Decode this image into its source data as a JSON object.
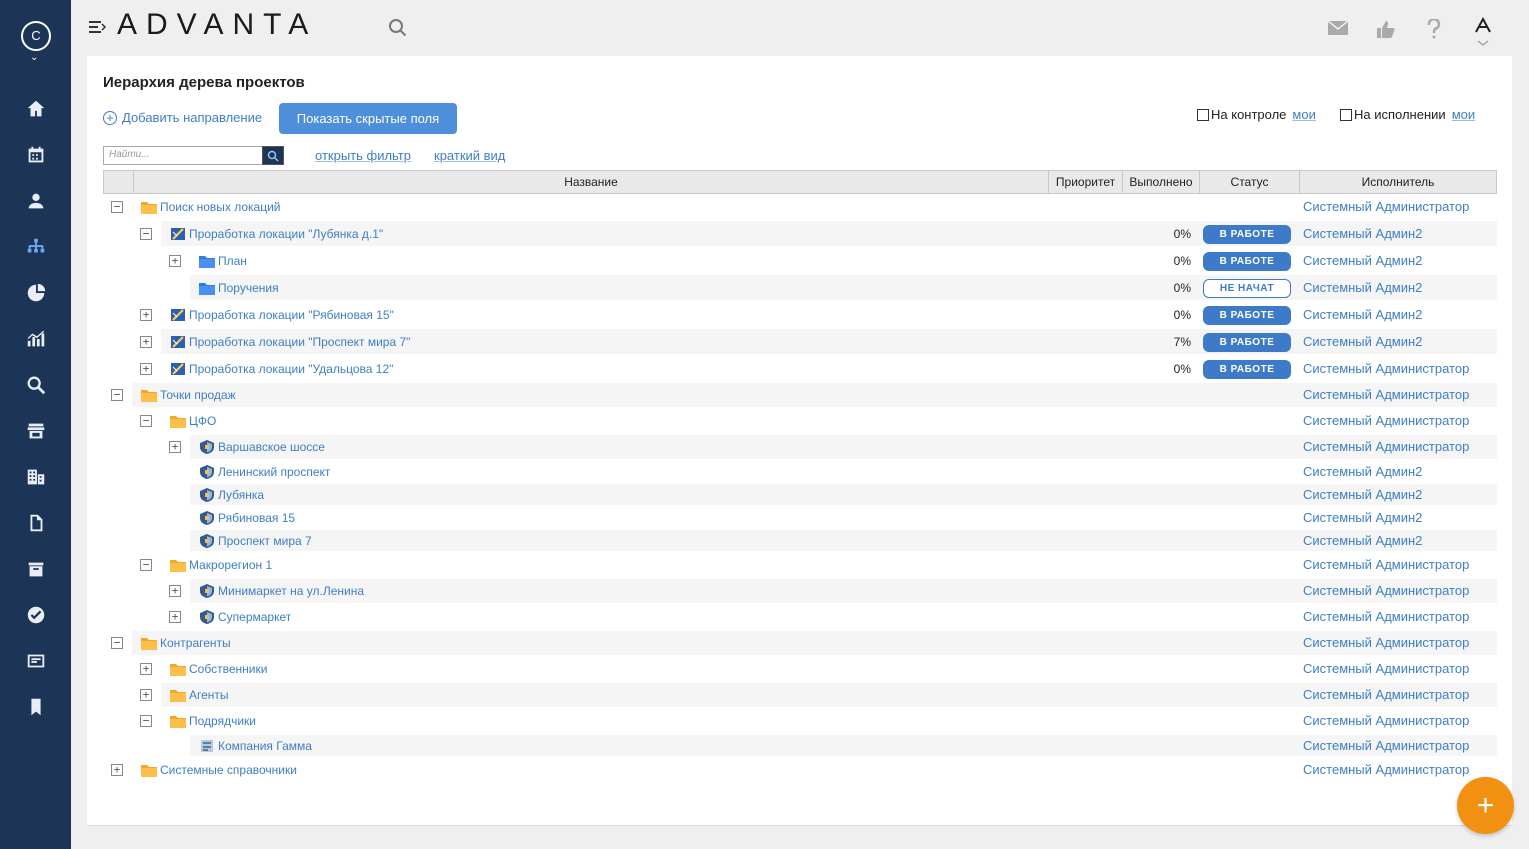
{
  "user": {
    "avatar_letter": "С"
  },
  "brand": {
    "logo": "ADVANTA"
  },
  "page": {
    "title": "Иерархия дерева проектов",
    "add_direction": "Добавить направление",
    "show_hidden": "Показать скрытые поля",
    "control_label": "На контроле",
    "execution_label": "На исполнении",
    "mine_link": "мои",
    "search_placeholder": "Найти...",
    "open_filter": "открыть фильтр",
    "short_view": "краткий вид"
  },
  "columns": {
    "name": "Название",
    "priority": "Приоритет",
    "done": "Выполнено",
    "status": "Статус",
    "owner": "Исполнитель"
  },
  "rows": [
    {
      "name": "Поиск новых локаций",
      "level": 0,
      "toggle": "−",
      "icon": "folder-orange-icon",
      "pct": "",
      "status": "",
      "owner": "Системный Администратор"
    },
    {
      "name": "Проработка локации \"Лубянка д.1\"",
      "level": 1,
      "toggle": "−",
      "icon": "project-icon",
      "pct": "0%",
      "status": "В РАБОТЕ",
      "owner": "Системный Админ2"
    },
    {
      "name": "План",
      "level": 2,
      "toggle": "+",
      "icon": "folder-blue-icon",
      "pct": "0%",
      "status": "В РАБОТЕ",
      "owner": "Системный Админ2"
    },
    {
      "name": "Поручения",
      "level": 2,
      "toggle": "",
      "icon": "folder-blue-icon",
      "pct": "0%",
      "status": "НЕ НАЧАТ",
      "owner": "Системный Админ2"
    },
    {
      "name": "Проработка локации \"Рябиновая 15\"",
      "level": 1,
      "toggle": "+",
      "icon": "project-icon",
      "pct": "0%",
      "status": "В РАБОТЕ",
      "owner": "Системный Админ2"
    },
    {
      "name": "Проработка локации \"Проспект мира 7\"",
      "level": 1,
      "toggle": "+",
      "icon": "project-icon",
      "pct": "7%",
      "status": "В РАБОТЕ",
      "owner": "Системный Админ2"
    },
    {
      "name": "Проработка локации \"Удальцова 12\"",
      "level": 1,
      "toggle": "+",
      "icon": "project-icon",
      "pct": "0%",
      "status": "В РАБОТЕ",
      "owner": "Системный Администратор"
    },
    {
      "name": "Точки продаж",
      "level": 0,
      "toggle": "−",
      "icon": "folder-orange-icon",
      "pct": "",
      "status": "",
      "owner": "Системный Администратор"
    },
    {
      "name": "ЦФО",
      "level": 1,
      "toggle": "−",
      "icon": "folder-orange-icon",
      "pct": "",
      "status": "",
      "owner": "Системный Администратор"
    },
    {
      "name": "Варшавское шоссе",
      "level": 2,
      "toggle": "+",
      "icon": "shield-icon",
      "pct": "",
      "status": "",
      "owner": "Системный Администратор"
    },
    {
      "name": "Ленинский проспект",
      "level": 2,
      "toggle": "",
      "icon": "shield-icon",
      "pct": "",
      "status": "",
      "owner": "Системный Админ2"
    },
    {
      "name": "Лубянка",
      "level": 2,
      "toggle": "",
      "icon": "shield-icon",
      "pct": "",
      "status": "",
      "owner": "Системный Админ2"
    },
    {
      "name": "Рябиновая 15",
      "level": 2,
      "toggle": "",
      "icon": "shield-icon",
      "pct": "",
      "status": "",
      "owner": "Системный Админ2"
    },
    {
      "name": "Проспект мира 7",
      "level": 2,
      "toggle": "",
      "icon": "shield-icon",
      "pct": "",
      "status": "",
      "owner": "Системный Админ2"
    },
    {
      "name": "Макрорегион 1",
      "level": 1,
      "toggle": "−",
      "icon": "folder-orange-icon",
      "pct": "",
      "status": "",
      "owner": "Системный Администратор"
    },
    {
      "name": "Минимаркет на ул.Ленина",
      "level": 2,
      "toggle": "+",
      "icon": "shield-icon",
      "pct": "",
      "status": "",
      "owner": "Системный Администратор"
    },
    {
      "name": "Супермаркет",
      "level": 2,
      "toggle": "+",
      "icon": "shield-icon",
      "pct": "",
      "status": "",
      "owner": "Системный Администратор"
    },
    {
      "name": "Контрагенты",
      "level": 0,
      "toggle": "−",
      "icon": "folder-orange-icon",
      "pct": "",
      "status": "",
      "owner": "Системный Администратор"
    },
    {
      "name": "Собственники",
      "level": 1,
      "toggle": "+",
      "icon": "folder-orange-icon",
      "pct": "",
      "status": "",
      "owner": "Системный Администратор"
    },
    {
      "name": "Агенты",
      "level": 1,
      "toggle": "+",
      "icon": "folder-orange-icon",
      "pct": "",
      "status": "",
      "owner": "Системный Администратор"
    },
    {
      "name": "Подрядчики",
      "level": 1,
      "toggle": "−",
      "icon": "folder-orange-icon",
      "pct": "",
      "status": "",
      "owner": "Системный Администратор"
    },
    {
      "name": "Компания Гамма",
      "level": 2,
      "toggle": "",
      "icon": "company-icon",
      "pct": "",
      "status": "",
      "owner": "Системный Администратор"
    },
    {
      "name": "Системные справочники",
      "level": 0,
      "toggle": "+",
      "icon": "folder-orange-icon",
      "pct": "",
      "status": "",
      "owner": "Системный Администратор"
    }
  ],
  "fab": {
    "label": "+"
  }
}
